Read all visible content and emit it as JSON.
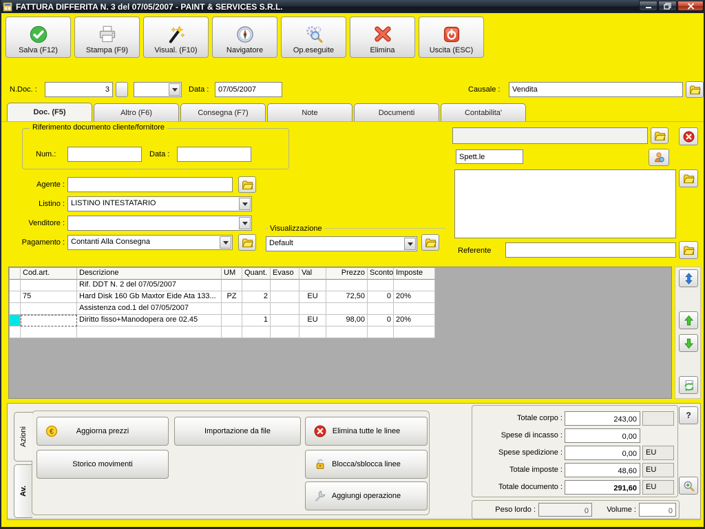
{
  "window": {
    "title": "FATTURA DIFFERITA N. 3  del 07/05/2007 - PAINT & SERVICES S.R.L."
  },
  "toolbar": {
    "buttons": [
      {
        "id": "salva",
        "label": "Salva (F12)",
        "icon": "check"
      },
      {
        "id": "stampa",
        "label": "Stampa (F9)",
        "icon": "printer"
      },
      {
        "id": "visual",
        "label": "Visual. (F10)",
        "icon": "wand"
      },
      {
        "id": "navigatore",
        "label": "Navigatore",
        "icon": "compass"
      },
      {
        "id": "op-eseguite",
        "label": "Op.eseguite",
        "icon": "gears"
      },
      {
        "id": "elimina",
        "label": "Elimina",
        "icon": "xmark"
      },
      {
        "id": "uscita",
        "label": "Uscita (ESC)",
        "icon": "power"
      }
    ]
  },
  "doc_fields": {
    "ndoc_label": "N.Doc. :",
    "ndoc_value": "3",
    "series_value": "",
    "data_label": "Data :",
    "data_value": "07/05/2007",
    "causale_label": "Causale :",
    "causale_value": "Vendita"
  },
  "tabs": {
    "active": 0,
    "items": [
      "Doc. (F5)",
      "Altro (F6)",
      "Consegna (F7)",
      "Note",
      "Documenti",
      "Contabilita'"
    ]
  },
  "rif_group": {
    "title": "Riferimento documento cliente/fornitore",
    "num_label": "Num.:",
    "num_value": "",
    "data_label": "Data :",
    "data_value": ""
  },
  "left_fields": {
    "agente_label": "Agente :",
    "agente_value": "",
    "listino_label": "Listino :",
    "listino_value": "LISTINO INTESTATARIO",
    "venditore_label": "Venditore :",
    "venditore_value": "",
    "pagamento_label": "Pagamento :",
    "pagamento_value": "Contanti Alla Consegna"
  },
  "visualizzazione": {
    "title": "Visualizzazione",
    "value": "Default"
  },
  "client_panel": {
    "intestatario_value": "",
    "spettle_value": "Spett.le",
    "address_value": "",
    "referente_label": "Referente",
    "referente_value": ""
  },
  "grid": {
    "columns": [
      {
        "label": "Cod.art.",
        "align": "left",
        "h": "left"
      },
      {
        "label": "Descrizione",
        "align": "left",
        "h": "left"
      },
      {
        "label": "UM",
        "align": "center",
        "h": "left"
      },
      {
        "label": "Quant.",
        "align": "right",
        "h": "left"
      },
      {
        "label": "Evaso",
        "align": "left",
        "h": "left"
      },
      {
        "label": "Val",
        "align": "center",
        "h": "left"
      },
      {
        "label": "Prezzo",
        "align": "right",
        "h": "right"
      },
      {
        "label": "Sconto",
        "align": "right",
        "h": "right"
      },
      {
        "label": "Imposte",
        "align": "left",
        "h": "left"
      }
    ],
    "rows": [
      {
        "cod": "",
        "desc": "Rif. DDT N. 2 del 07/05/2007",
        "um": "",
        "quant": "",
        "evaso": "",
        "val": "",
        "prezzo": "",
        "sconto": "",
        "imposte": "",
        "selected": false
      },
      {
        "cod": "75",
        "desc": "Hard Disk 160 Gb Maxtor Eide Ata 133...",
        "um": "PZ",
        "quant": "2",
        "evaso": "",
        "val": "EU",
        "prezzo": "72,50",
        "sconto": "0",
        "imposte": "20%",
        "selected": false
      },
      {
        "cod": "",
        "desc": "Assistenza cod.1 del 07/05/2007",
        "um": "",
        "quant": "",
        "evaso": "",
        "val": "",
        "prezzo": "",
        "sconto": "",
        "imposte": "",
        "selected": false
      },
      {
        "cod": "",
        "desc": "Diritto fisso+Manodopera ore 02.45",
        "um": "",
        "quant": "1",
        "evaso": "",
        "val": "EU",
        "prezzo": "98,00",
        "sconto": "0",
        "imposte": "20%",
        "selected": true
      },
      {
        "cod": "",
        "desc": "",
        "um": "",
        "quant": "",
        "evaso": "",
        "val": "",
        "prezzo": "",
        "sconto": "",
        "imposte": "",
        "selected": false
      }
    ]
  },
  "actions": {
    "tabs": [
      {
        "label": "Azioni",
        "active": true
      },
      {
        "label": "Av.",
        "active": false
      }
    ],
    "buttons": [
      {
        "label": "Aggiorna prezzi",
        "icon": "euro"
      },
      {
        "label": "Importazione da file",
        "icon": ""
      },
      {
        "label": "Elimina tutte le linee",
        "icon": "xcircle"
      },
      {
        "label": "Storico movimenti",
        "icon": ""
      },
      {
        "label": "Blocca/sblocca linee",
        "icon": "lock"
      },
      {
        "label": "Aggiungi operazione",
        "icon": "wrench"
      }
    ]
  },
  "totals": {
    "help_label": "?",
    "rows": [
      {
        "label": "Totale corpo :",
        "value": "243,00",
        "currency": "",
        "box": true,
        "bold": false
      },
      {
        "label": "Spese di incasso :",
        "value": "0,00",
        "currency": "",
        "box": false,
        "bold": false
      },
      {
        "label": "Spese spedizione :",
        "value": "0,00",
        "currency": "EU",
        "box": true,
        "bold": false
      },
      {
        "label": "Totale imposte :",
        "value": "48,60",
        "currency": "EU",
        "box": true,
        "bold": false
      },
      {
        "label": "Totale documento :",
        "value": "291,60",
        "currency": "EU",
        "box": true,
        "bold": true
      }
    ]
  },
  "weights": {
    "peso_label": "Peso lordo :",
    "peso_value": "0",
    "volume_label": "Volume :",
    "volume_value": "0"
  },
  "colors": {
    "background": "#f8ec00",
    "grid_filler": "#acacac",
    "selection": "#00e6e6",
    "accent_green": "#46b94a",
    "accent_red": "#e8442e"
  }
}
